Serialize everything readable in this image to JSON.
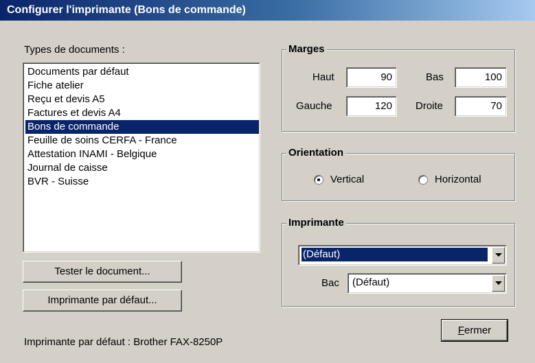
{
  "window": {
    "title": "Configurer l'imprimante (Bons de commande)"
  },
  "documents": {
    "label": "Types de documents :",
    "items": [
      "Documents par défaut",
      "Fiche atelier",
      "Reçu et devis A5",
      "Factures et devis A4",
      "Bons de commande",
      "Feuille de soins CERFA - France",
      "Attestation INAMI - Belgique",
      "Journal de caisse",
      "BVR - Suisse"
    ],
    "selected_index": 4
  },
  "buttons": {
    "test": "Tester le document...",
    "default_printer": "Imprimante par défaut...",
    "close": "Fermer"
  },
  "status": {
    "default_printer": "Imprimante par défaut : Brother FAX-8250P"
  },
  "margins": {
    "title": "Marges",
    "top_label": "Haut",
    "top_value": "90",
    "bottom_label": "Bas",
    "bottom_value": "100",
    "left_label": "Gauche",
    "left_value": "120",
    "right_label": "Droite",
    "right_value": "70"
  },
  "orientation": {
    "title": "Orientation",
    "vertical": "Vertical",
    "horizontal": "Horizontal",
    "selected": "vertical"
  },
  "printer": {
    "title": "Imprimante",
    "printer_value": "(Défaut)",
    "tray_label": "Bac",
    "tray_value": "(Défaut)"
  },
  "colors": {
    "selection": "#0a246a",
    "face": "#d4d0c8"
  }
}
